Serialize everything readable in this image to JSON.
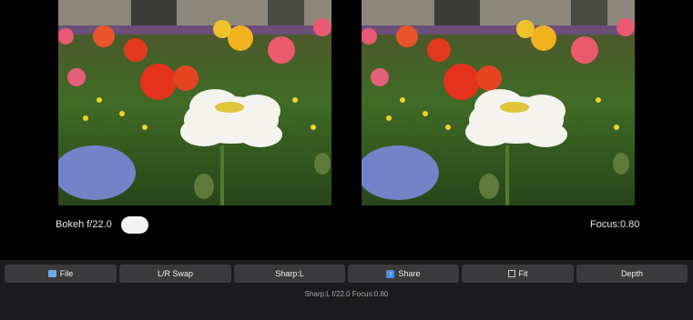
{
  "viewer": {
    "left_image": "flower-garden-photo-sharp",
    "right_image": "flower-garden-photo-focus"
  },
  "controls": {
    "bokeh_label": "Bokeh f/22.0",
    "bokeh_toggle_on": true,
    "focus_label": "Focus:0.80"
  },
  "toolbar": {
    "file_label": "File",
    "file_icon": "folder-icon",
    "swap_label": "L/R Swap",
    "sharp_label": "Sharp:L",
    "share_label": "Share",
    "share_icon": "share-icon",
    "fit_label": "Fit",
    "fit_icon": "square-icon",
    "depth_label": "Depth"
  },
  "status": {
    "text": "Sharp:L  f/22.0  Focus:0.80"
  },
  "colors": {
    "background": "#000000",
    "toolbar": "#1b1b1d",
    "button": "#3a3a3c",
    "accent": "#4c8fe0"
  }
}
